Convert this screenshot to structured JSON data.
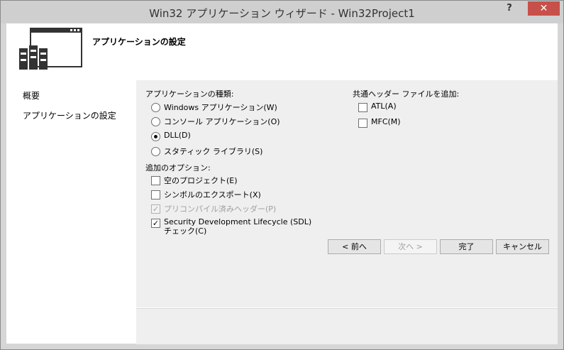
{
  "window": {
    "title": "Win32 アプリケーション ウィザード - Win32Project1",
    "help_label": "?",
    "close_label": "✕"
  },
  "header": {
    "title": "アプリケーションの設定"
  },
  "sidebar": {
    "items": [
      {
        "label": "概要"
      },
      {
        "label": "アプリケーションの設定"
      }
    ]
  },
  "app_type": {
    "heading": "アプリケーションの種類:",
    "options": [
      {
        "label": "Windows アプリケーション(W)",
        "selected": false
      },
      {
        "label": "コンソール アプリケーション(O)",
        "selected": false
      },
      {
        "label": "DLL(D)",
        "selected": true
      },
      {
        "label": "スタティック ライブラリ(S)",
        "selected": false
      }
    ]
  },
  "additional": {
    "heading": "追加のオプション:",
    "options": [
      {
        "label": "空のプロジェクト(E)",
        "checked": false,
        "enabled": true
      },
      {
        "label": "シンボルのエクスポート(X)",
        "checked": false,
        "enabled": true
      },
      {
        "label": "プリコンパイル済みヘッダー(P)",
        "checked": true,
        "enabled": false
      },
      {
        "label": "Security Development Lifecycle (SDL) チェック(C)",
        "checked": true,
        "enabled": true
      }
    ]
  },
  "common_headers": {
    "heading": "共通ヘッダー ファイルを追加:",
    "options": [
      {
        "label": "ATL(A)",
        "checked": false
      },
      {
        "label": "MFC(M)",
        "checked": false
      }
    ]
  },
  "buttons": {
    "back": "< 前へ",
    "next": "次へ >",
    "finish": "完了",
    "cancel": "キャンセル"
  }
}
